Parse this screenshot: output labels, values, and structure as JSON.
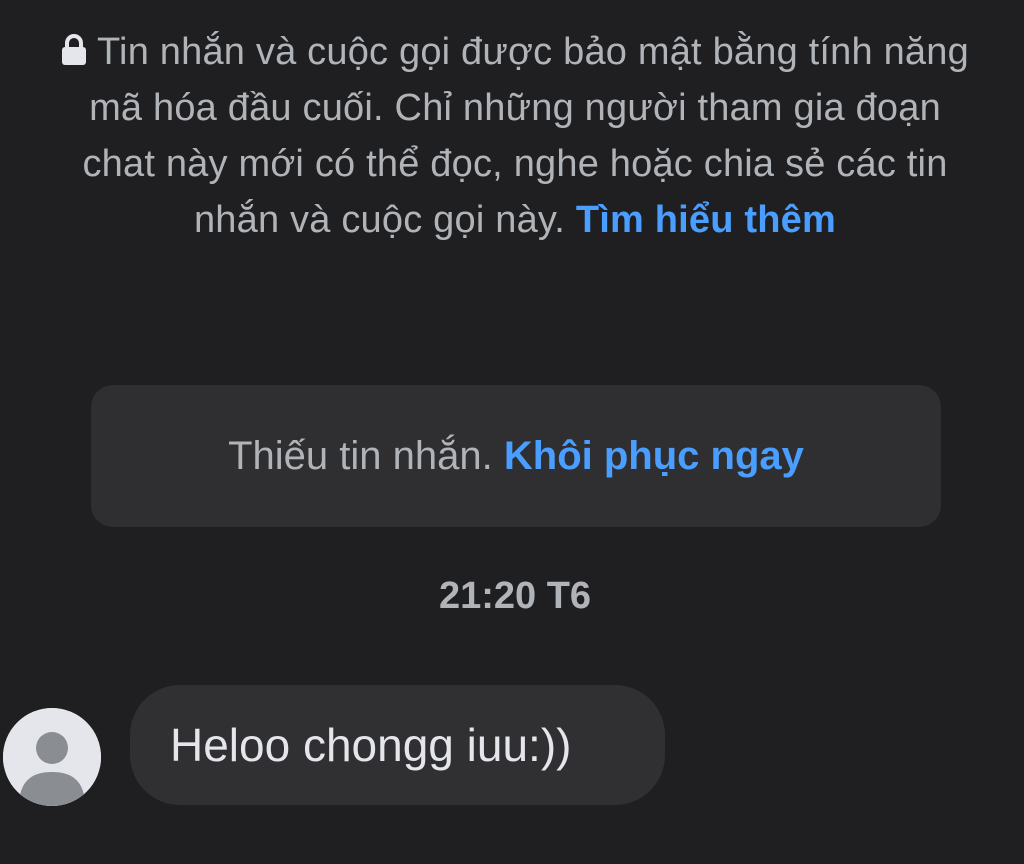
{
  "encryption_notice": {
    "text": "Tin nhắn và cuộc gọi được bảo mật bằng tính năng mã hóa đầu cuối. Chỉ những người tham gia đoạn chat này mới có thể đọc, nghe hoặc chia sẻ các tin nhắn và cuộc gọi này.",
    "link_label": "Tìm hiểu thêm",
    "icon": "lock-icon"
  },
  "missing_messages": {
    "text": "Thiếu tin nhắn.",
    "link_label": "Khôi phục ngay"
  },
  "timestamp": "21:20 T6",
  "message": {
    "text": "Heloo chongg iuu:))",
    "avatar_icon": "default-avatar-icon"
  },
  "colors": {
    "background": "#1f1f21",
    "link": "#4a9eff",
    "bubble": "#303032",
    "muted_text": "#b0b3b8",
    "message_text": "#e4e6eb"
  }
}
